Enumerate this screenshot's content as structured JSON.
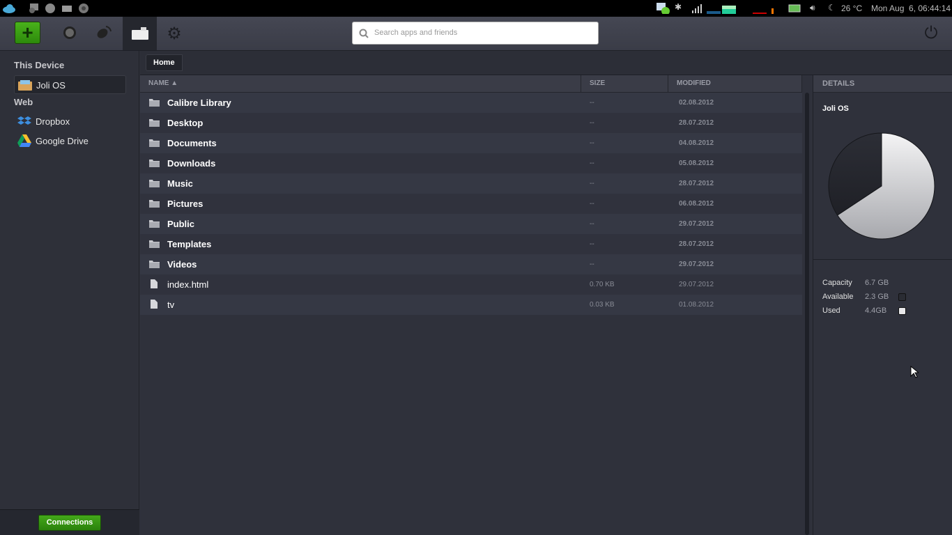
{
  "topbar": {
    "temperature": "26 °C",
    "clock": "Mon Aug  6, 06:44:14"
  },
  "search": {
    "placeholder": "Search apps and friends"
  },
  "sidebar": {
    "this_device": "This Device",
    "device_item": "Joli OS",
    "web": "Web",
    "web_items": [
      {
        "label": "Dropbox"
      },
      {
        "label": "Google Drive"
      }
    ],
    "connections": "Connections"
  },
  "breadcrumb": {
    "home": "Home"
  },
  "table": {
    "headers": {
      "name": "NAME ▲",
      "size": "SIZE",
      "modified": "MODIFIED"
    },
    "rows": [
      {
        "name": "Calibre Library",
        "type": "folder",
        "size": "--",
        "modified": "02.08.2012"
      },
      {
        "name": "Desktop",
        "type": "folder",
        "size": "--",
        "modified": "28.07.2012"
      },
      {
        "name": "Documents",
        "type": "folder",
        "size": "--",
        "modified": "04.08.2012"
      },
      {
        "name": "Downloads",
        "type": "folder",
        "size": "--",
        "modified": "05.08.2012"
      },
      {
        "name": "Music",
        "type": "folder",
        "size": "--",
        "modified": "28.07.2012"
      },
      {
        "name": "Pictures",
        "type": "folder",
        "size": "--",
        "modified": "06.08.2012"
      },
      {
        "name": "Public",
        "type": "folder",
        "size": "--",
        "modified": "29.07.2012"
      },
      {
        "name": "Templates",
        "type": "folder",
        "size": "--",
        "modified": "28.07.2012"
      },
      {
        "name": "Videos",
        "type": "folder",
        "size": "--",
        "modified": "29.07.2012"
      },
      {
        "name": "index.html",
        "type": "file",
        "size": "0.70 KB",
        "modified": "29.07.2012"
      },
      {
        "name": "tv",
        "type": "file",
        "size": "0.03 KB",
        "modified": "01.08.2012"
      }
    ]
  },
  "details": {
    "header": "DETAILS",
    "title": "Joli OS",
    "capacity_label": "Capacity",
    "capacity": "6.7 GB",
    "available_label": "Available",
    "available": "2.3 GB",
    "used_label": "Used",
    "used": "4.4GB",
    "used_fraction": 0.657,
    "colors": {
      "available": "#2a2c33",
      "used": "#e8e8ea"
    }
  }
}
